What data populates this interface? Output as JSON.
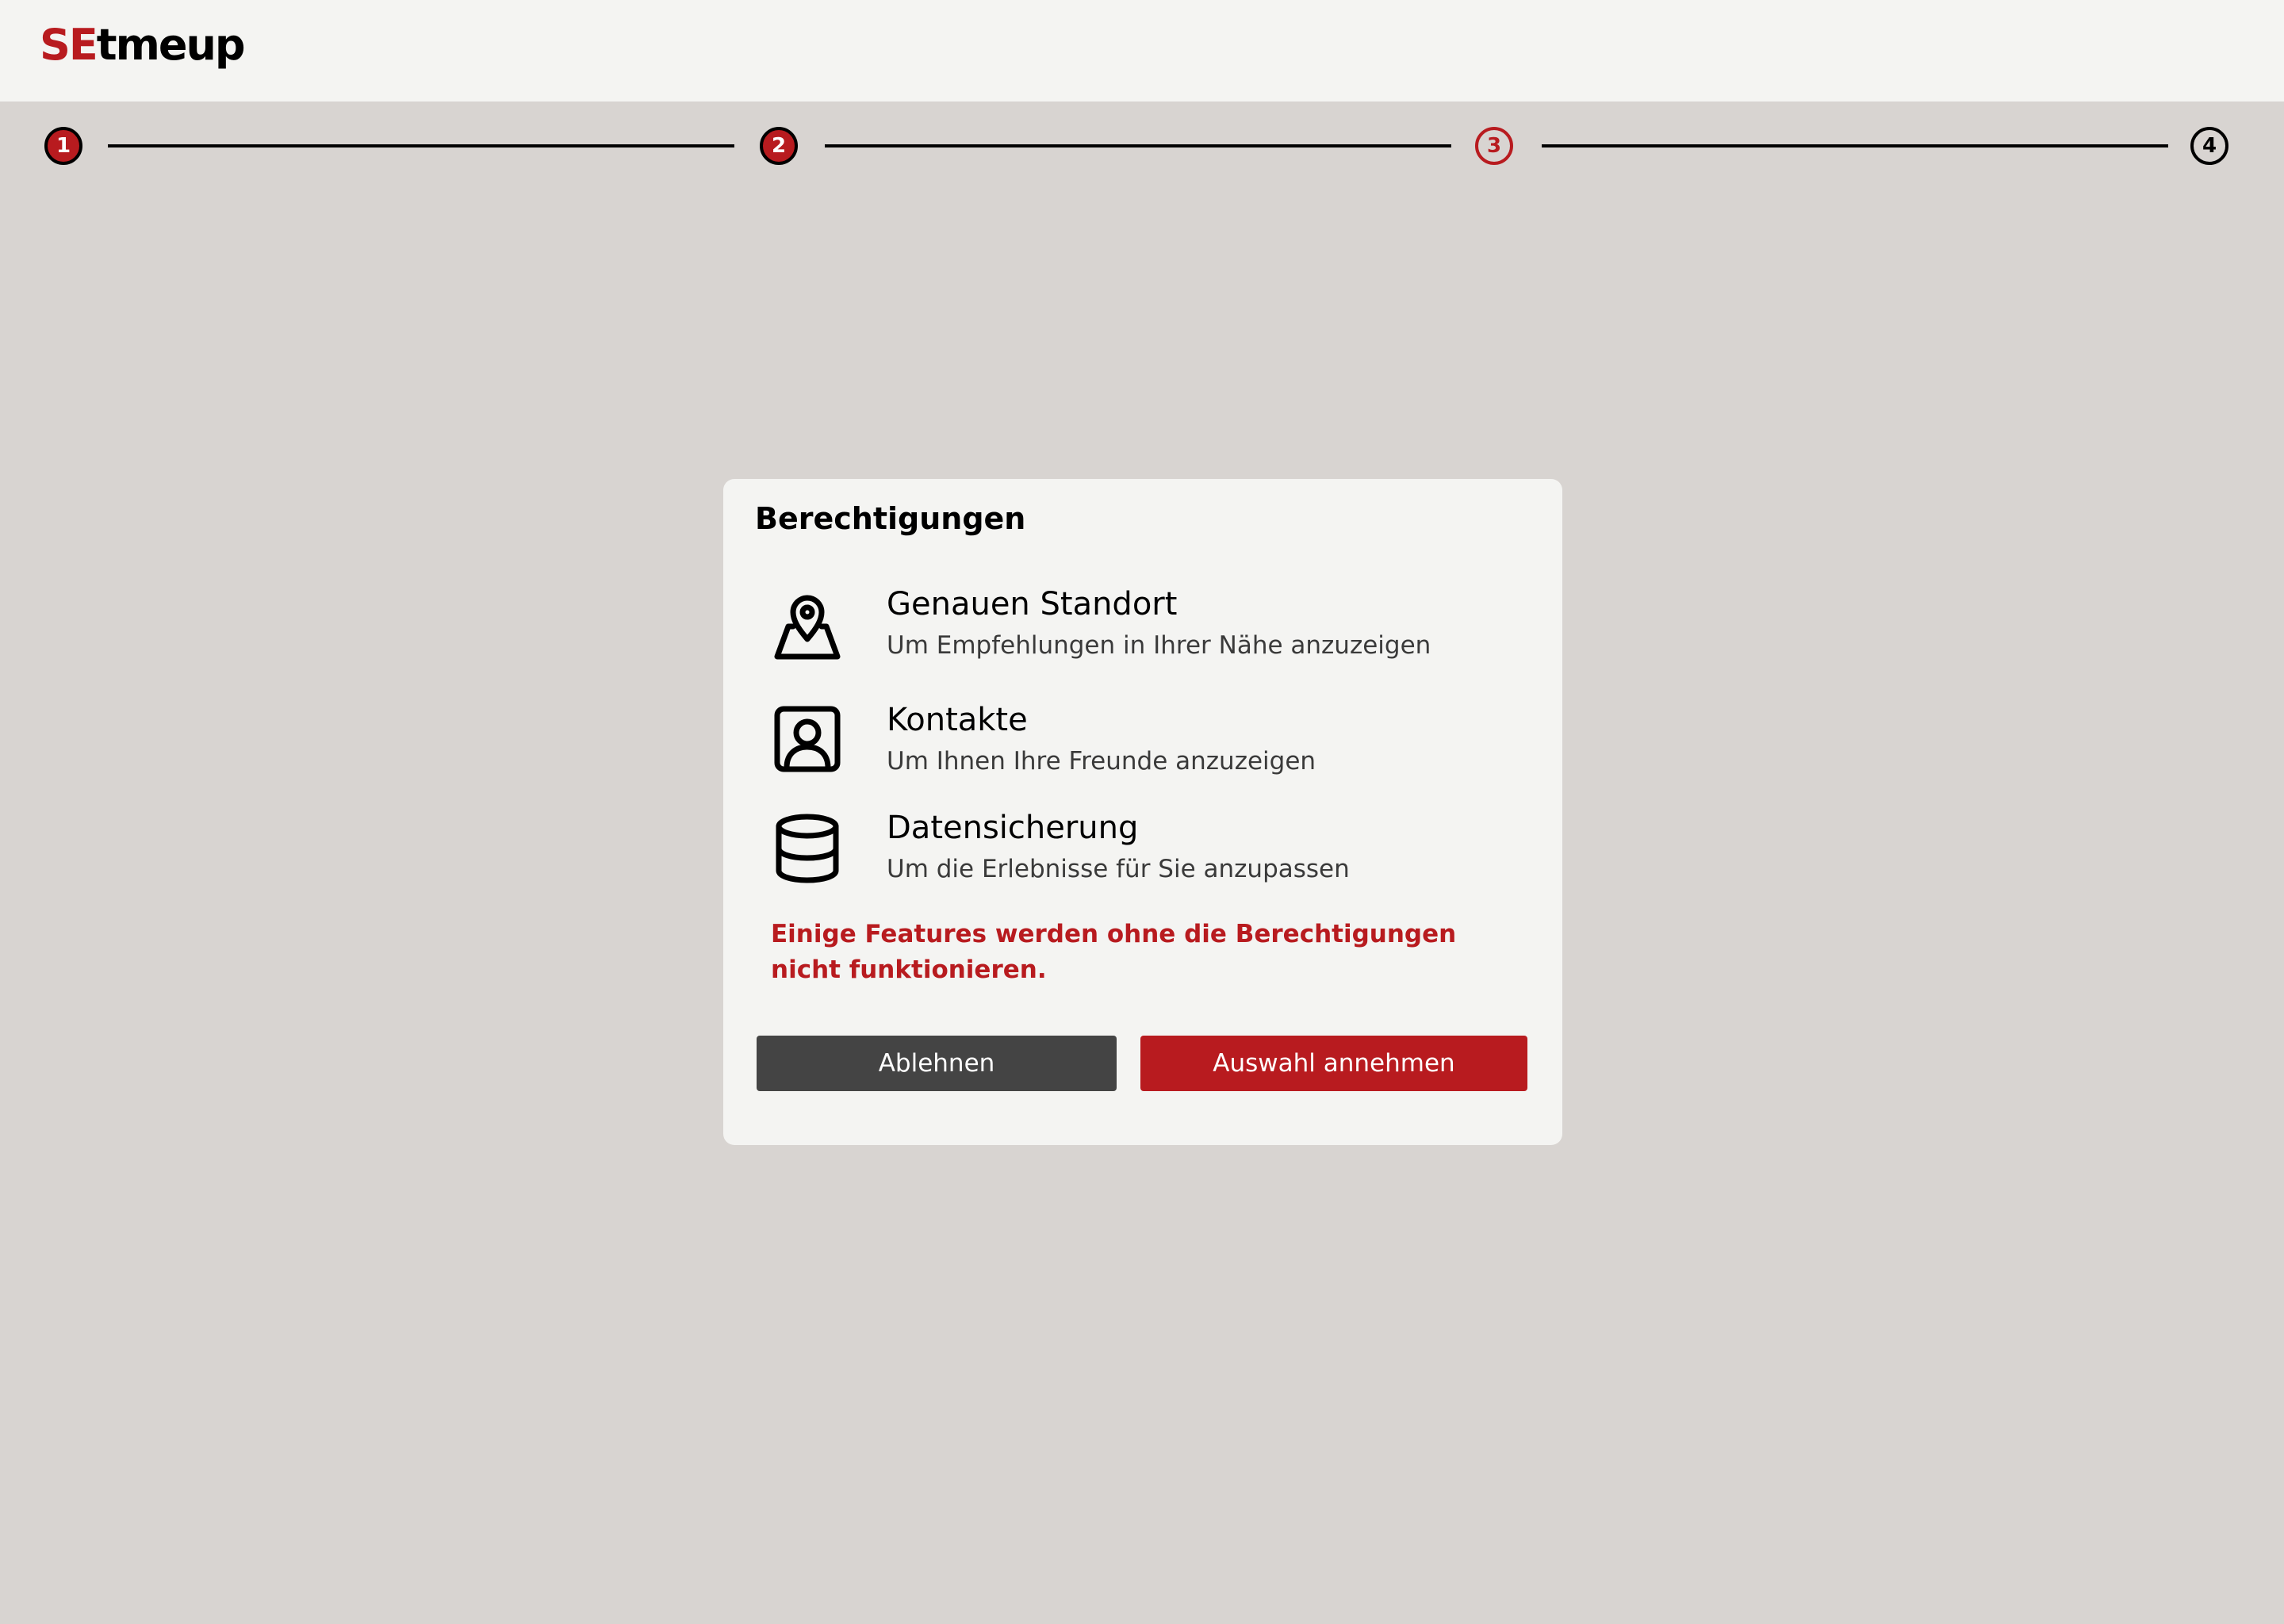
{
  "header": {
    "logo_part1": "SE",
    "logo_part2": "tmeup"
  },
  "stepper": {
    "steps": [
      {
        "label": "1",
        "state": "done"
      },
      {
        "label": "2",
        "state": "done"
      },
      {
        "label": "3",
        "state": "current"
      },
      {
        "label": "4",
        "state": "todo"
      }
    ]
  },
  "dialog": {
    "title": "Berechtigungen",
    "permissions": [
      {
        "icon": "map-pin-icon",
        "title": "Genauen Standort",
        "description": "Um Empfehlungen in Ihrer Nähe anzuzeigen"
      },
      {
        "icon": "contact-icon",
        "title": "Kontakte",
        "description": "Um Ihnen Ihre Freunde anzuzeigen"
      },
      {
        "icon": "database-icon",
        "title": "Datensicherung",
        "description": "Um die Erlebnisse für Sie anzupassen"
      }
    ],
    "warning": "Einige Features werden ohne die Berechtigungen nicht funktionieren.",
    "decline_label": "Ablehnen",
    "accept_label": "Auswahl annehmen"
  },
  "colors": {
    "brand_red": "#b81b1f",
    "background": "#d8d4d1",
    "surface": "#f4f4f2",
    "decline_button": "#444444"
  }
}
